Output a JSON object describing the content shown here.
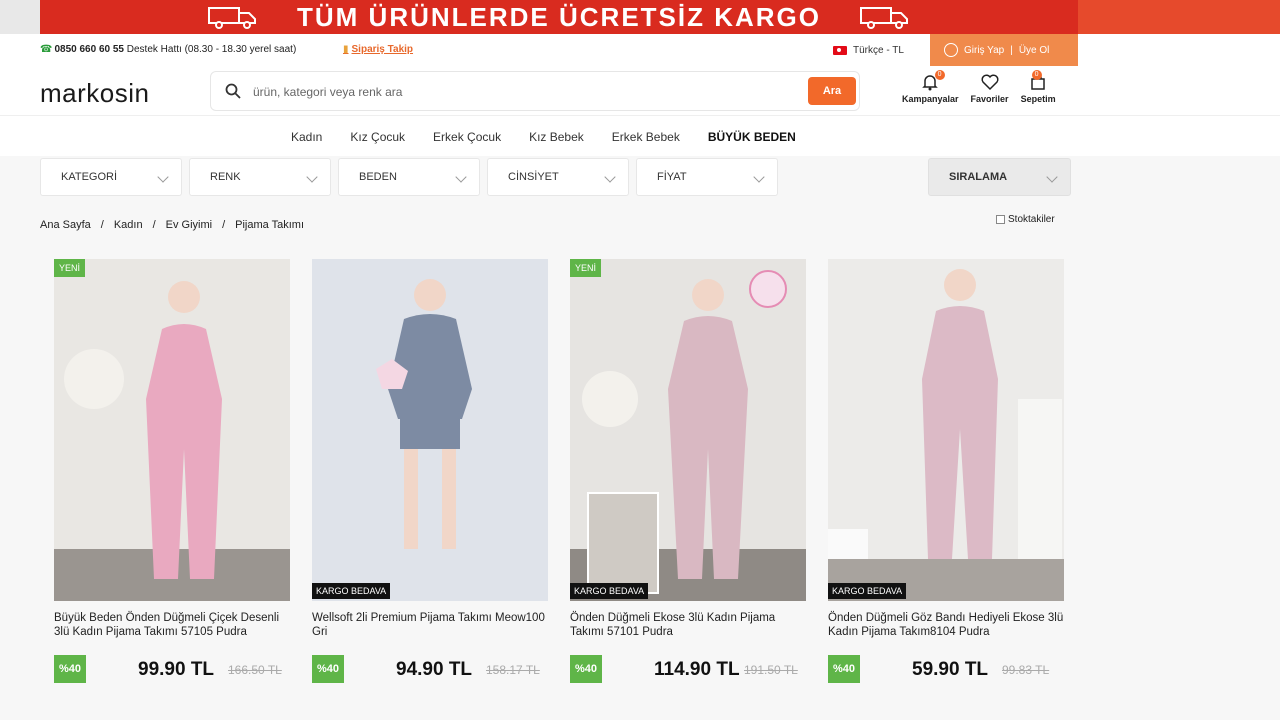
{
  "banner": {
    "text": "TÜM ÜRÜNLERDE ÜCRETSİZ KARGO"
  },
  "topbar": {
    "phone": "0850 660 60 55",
    "support_text": "Destek Hattı (08.30 - 18.30 yerel saat)",
    "order_track": "Sipariş Takip",
    "language": "Türkçe - TL",
    "login": "Giriş Yap",
    "separator": "|",
    "register": "Üye Ol"
  },
  "header": {
    "logo": "markosin",
    "search_placeholder": "ürün, kategori veya renk ara",
    "search_button": "Ara",
    "icons": [
      {
        "label": "Kampanyalar",
        "count": "0"
      },
      {
        "label": "Favoriler",
        "count": ""
      },
      {
        "label": "Sepetim",
        "count": "0"
      }
    ]
  },
  "nav": {
    "items": [
      "Kadın",
      "Kız Çocuk",
      "Erkek Çocuk",
      "Kız Bebek",
      "Erkek Bebek",
      "BÜYÜK BEDEN"
    ]
  },
  "filters": {
    "category": "KATEGORİ",
    "color": "RENK",
    "size": "BEDEN",
    "gender": "CİNSİYET",
    "price": "FİYAT",
    "sort": "SIRALAMA"
  },
  "breadcrumb": [
    "Ana Sayfa",
    "Kadın",
    "Ev Giyimi",
    "Pijama Takımı"
  ],
  "breadcrumb_sep": "/",
  "stock_filter": "Stoktakiler",
  "products": [
    {
      "badge_new": "YENİ",
      "badge_kargo": "",
      "title": "Büyük Beden Önden Düğmeli Çiçek Desenli 3lü Kadın Pijama Takımı 57105 Pudra",
      "discount": "%40",
      "price": "99.90 TL",
      "old_price": "166.50 TL",
      "bg": "#e9e7e3",
      "garment": "#e9a9c0"
    },
    {
      "badge_new": "",
      "badge_kargo": "KARGO BEDAVA",
      "title": "Wellsoft 2li Premium Pijama Takımı Meow100 Gri",
      "discount": "%40",
      "price": "94.90 TL",
      "old_price": "158.17 TL",
      "bg": "#dfe3ea",
      "garment": "#7d8ba3"
    },
    {
      "badge_new": "YENİ",
      "badge_kargo": "KARGO BEDAVA",
      "title": "Önden Düğmeli Ekose 3lü Kadın Pijama Takımı 57101 Pudra",
      "discount": "%40",
      "price": "114.90 TL",
      "old_price": "191.50 TL",
      "bg": "#e6e4e1",
      "garment": "#d9b8c2"
    },
    {
      "badge_new": "",
      "badge_kargo": "KARGO BEDAVA",
      "title": "Önden Düğmeli Göz Bandı Hediyeli Ekose 3lü Kadın Pijama Takım8104 Pudra",
      "discount": "%40",
      "price": "59.90 TL",
      "old_price": "99.83 TL",
      "bg": "#ecebe9",
      "garment": "#dcbac6"
    }
  ]
}
